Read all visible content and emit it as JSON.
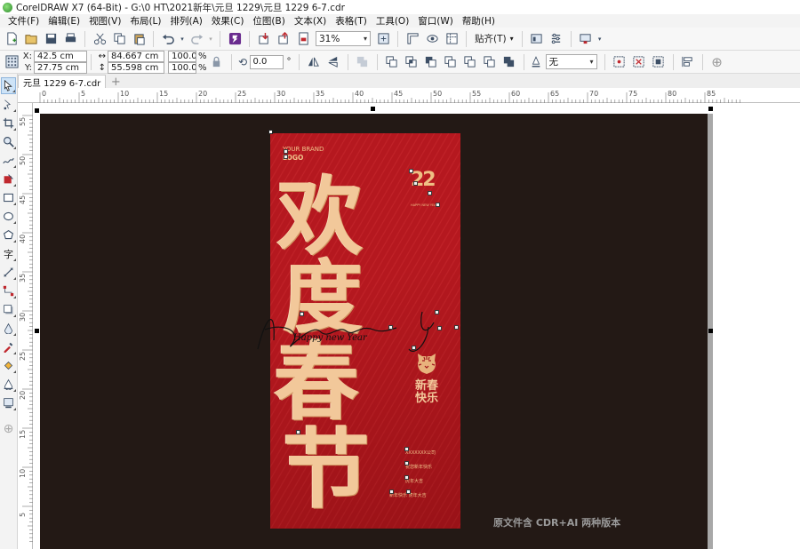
{
  "window": {
    "title": "CorelDRAW X7 (64-Bit) - G:\\0 HT\\2021新年\\元旦 1229\\元旦 1229 6-7.cdr"
  },
  "menu": [
    "文件(F)",
    "编辑(E)",
    "视图(V)",
    "布局(L)",
    "排列(A)",
    "效果(C)",
    "位图(B)",
    "文本(X)",
    "表格(T)",
    "工具(O)",
    "窗口(W)",
    "帮助(H)"
  ],
  "toolbar": {
    "zoom": "31%",
    "snap_label": "贴齐(T)"
  },
  "property_bar": {
    "x_label": "X:",
    "x_value": "42.5 cm",
    "y_label": "Y:",
    "y_value": "27.75 cm",
    "width_value": "84.667 cm",
    "height_value": "55.598 cm",
    "scale_w": "100.0",
    "scale_h": "100.0",
    "percent": "%",
    "rotation": "0.0",
    "degree": "°",
    "outline": "无"
  },
  "tabs": {
    "document": "元旦 1229 6-7.cdr",
    "add": "+"
  },
  "ruler": {
    "h_ticks": [
      "0",
      "5",
      "10",
      "15",
      "20",
      "25",
      "30",
      "35",
      "40",
      "45",
      "50",
      "55",
      "60",
      "65",
      "70",
      "75",
      "80",
      "85"
    ],
    "v_ticks": [
      "55",
      "50",
      "45",
      "40",
      "35",
      "30",
      "25",
      "20",
      "15",
      "10",
      "5"
    ]
  },
  "poster": {
    "brand_line1": "YOUR BRAND",
    "brand_line2": "LOGO",
    "char1": "欢",
    "char2": "度",
    "char3": "春",
    "char4": "节",
    "year": "22",
    "year_sub": "HAPPY NEW YEAR",
    "xinchun": "新春",
    "kuaile": "快乐",
    "script": "Happy new Year",
    "info1": "XXXXXXX公司",
    "info2": "祝您新年快乐",
    "info3": "虎年大吉",
    "info4": "新年快乐 虎年大吉"
  },
  "watermark": "原文件含 CDR+AI 两种版本"
}
